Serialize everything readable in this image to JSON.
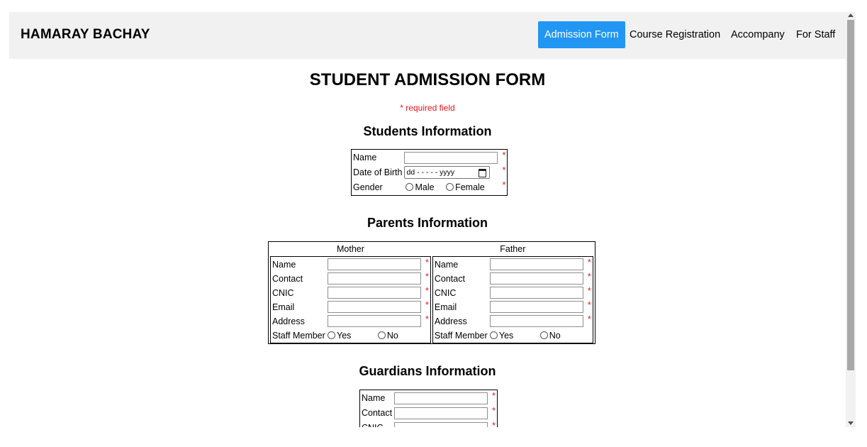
{
  "navbar": {
    "brand": "HAMARAY BACHAY",
    "links": [
      "Admission Form",
      "Course Registration",
      "Accompany",
      "For Staff"
    ],
    "active_color": "#2196F3"
  },
  "page": {
    "title": "STUDENT ADMISSION FORM",
    "required_note": "* required field",
    "required_color": "#e8141a"
  },
  "student": {
    "heading": "Students Information",
    "name_label": "Name",
    "dob_label": "Date of Birth",
    "dob_placeholder": "dd - - - - - yyyy",
    "gender_label": "Gender",
    "gender_options": [
      "Male",
      "Female"
    ]
  },
  "parents": {
    "heading": "Parents Information",
    "mother_heading": "Mother",
    "father_heading": "Father",
    "fields": [
      "Name",
      "Contact",
      "CNIC",
      "Email",
      "Address"
    ],
    "staff_label": "Staff Member",
    "staff_options": [
      "Yes",
      "No"
    ]
  },
  "guardians": {
    "heading": "Guardians Information",
    "fields": [
      "Name",
      "Contact",
      "CNIC"
    ]
  },
  "star": "*"
}
